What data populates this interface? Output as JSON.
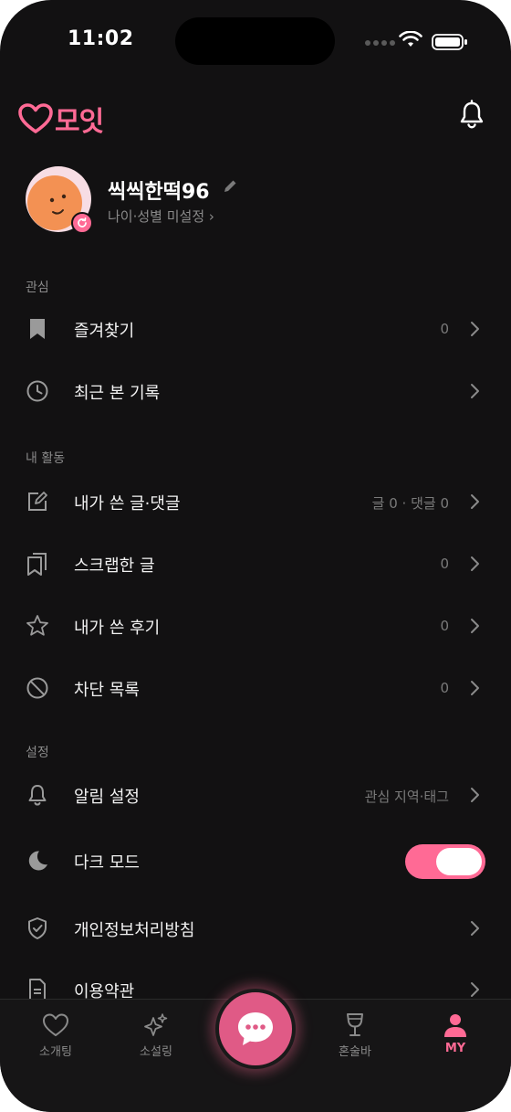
{
  "status_bar": {
    "time": "11:02"
  },
  "header": {
    "logo_text": "모잇"
  },
  "profile": {
    "nickname": "씩씩한떡96",
    "subinfo": "나이·성별 미설정 ›"
  },
  "sections": {
    "interest": {
      "title": "관심",
      "items": [
        {
          "label": "즐겨찾기",
          "value": "0",
          "icon": "bookmark-icon"
        },
        {
          "label": "최근 본 기록",
          "value": "",
          "icon": "clock-icon"
        }
      ]
    },
    "activity": {
      "title": "내 활동",
      "items": [
        {
          "label": "내가 쓴 글·댓글",
          "value": "글 0 · 댓글 0",
          "icon": "edit-icon"
        },
        {
          "label": "스크랩한 글",
          "value": "0",
          "icon": "scrap-icon"
        },
        {
          "label": "내가 쓴 후기",
          "value": "0",
          "icon": "star-icon"
        },
        {
          "label": "차단 목록",
          "value": "0",
          "icon": "block-icon"
        }
      ]
    },
    "settings": {
      "title": "설정",
      "items": [
        {
          "label": "알림 설정",
          "value": "관심 지역·태그",
          "icon": "bell-icon"
        },
        {
          "label": "다크 모드",
          "value": "",
          "icon": "moon-icon",
          "toggle": true
        },
        {
          "label": "개인정보처리방침",
          "value": "",
          "icon": "shield-icon"
        },
        {
          "label": "이용약관",
          "value": "",
          "icon": "document-icon"
        }
      ]
    }
  },
  "tabbar": {
    "tabs": [
      {
        "label": "소개팅",
        "icon": "heart-icon"
      },
      {
        "label": "소설링",
        "icon": "sparkle-icon"
      },
      {
        "label": "",
        "icon": "chat-icon"
      },
      {
        "label": "혼술바",
        "icon": "glass-icon"
      },
      {
        "label": "MY",
        "icon": "person-icon"
      }
    ],
    "active": "MY"
  },
  "colors": {
    "accent": "#ff6a95",
    "background": "#121112",
    "text_muted": "#8a8a8a"
  }
}
